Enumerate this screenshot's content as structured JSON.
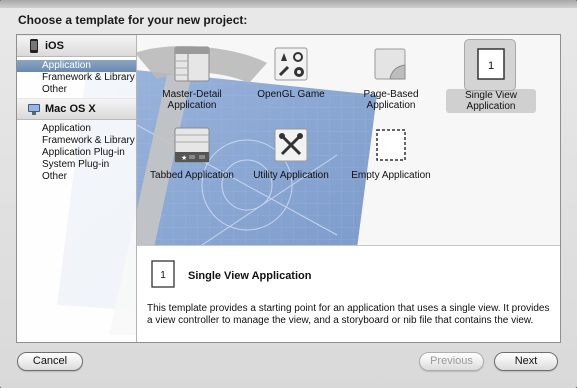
{
  "heading": "Choose a template for your new project:",
  "sidebar": {
    "sections": [
      {
        "title": "iOS",
        "icon": "iphone-icon",
        "items": [
          "Application",
          "Framework & Library",
          "Other"
        ],
        "selected": "Application"
      },
      {
        "title": "Mac OS X",
        "icon": "mac-icon",
        "items": [
          "Application",
          "Framework & Library",
          "Application Plug-in",
          "System Plug-in",
          "Other"
        ]
      }
    ]
  },
  "templates": [
    {
      "label": "Master-Detail Application",
      "icon": "master-detail-icon"
    },
    {
      "label": "OpenGL Game",
      "icon": "opengl-game-icon"
    },
    {
      "label": "Page-Based Application",
      "icon": "page-curl-icon"
    },
    {
      "label": "Single View Application",
      "icon": "single-view-icon",
      "selected": true
    },
    {
      "label": "Tabbed Application",
      "icon": "tabbed-icon"
    },
    {
      "label": "Utility Application",
      "icon": "utility-tools-icon"
    },
    {
      "label": "Empty Application",
      "icon": "empty-dashed-icon"
    }
  ],
  "description": {
    "title": "Single View Application",
    "text": "This template provides a starting point for an application that uses a single view. It provides a view controller to manage the view, and a storyboard or nib file that contains the view."
  },
  "buttons": {
    "cancel": "Cancel",
    "previous": "Previous",
    "next": "Next"
  },
  "colors": {
    "selection": "#7c98bb",
    "blueprint": "#5b82c0"
  }
}
